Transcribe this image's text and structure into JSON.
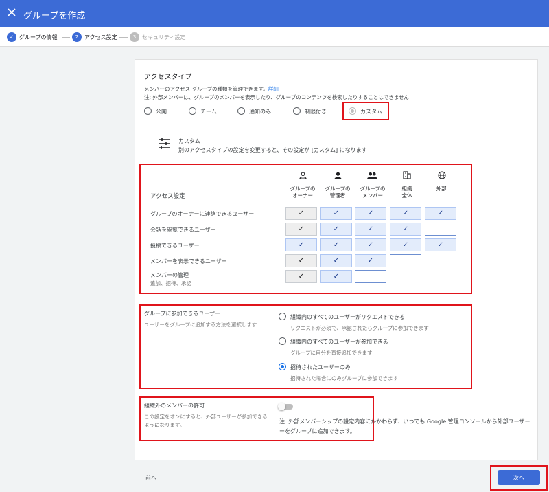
{
  "topbar": {
    "title": "グループを作成"
  },
  "stepper": [
    {
      "num": "✓",
      "label": "グループの情報"
    },
    {
      "num": "2",
      "label": "アクセス設定"
    },
    {
      "num": "3",
      "label": "セキュリティ設定"
    }
  ],
  "access_type": {
    "title": "アクセスタイプ",
    "desc": "メンバーのアクセス グループの種類を管理できます。",
    "desc_link": "詳細",
    "note": "注: 外部メンバーは、グループのメンバーを表示したり、グループのコンテンツを検索したりすることはできません",
    "options": [
      "公開",
      "チーム",
      "通知のみ",
      "制限付き",
      "カスタム"
    ],
    "selected": "カスタム"
  },
  "custom_info": {
    "title": "カスタム",
    "desc": "別のアクセスタイプの設定を変更すると、その設定が [カスタム] になります"
  },
  "access_settings": {
    "title": "アクセス設定",
    "columns": [
      {
        "l1": "グループの",
        "l2": "オーナー",
        "icon": "owner-icon"
      },
      {
        "l1": "グループの",
        "l2": "管理者",
        "icon": "manager-icon"
      },
      {
        "l1": "グループの",
        "l2": "メンバー",
        "icon": "members-icon"
      },
      {
        "l1": "組織",
        "l2": "全体",
        "icon": "organization-icon"
      },
      {
        "l1": "外部",
        "l2": "",
        "icon": "globe-icon"
      }
    ],
    "rows": [
      {
        "label": "グループのオーナーに連絡できるユーザー",
        "sub": ""
      },
      {
        "label": "会話を閲覧できるユーザー",
        "sub": ""
      },
      {
        "label": "投稿できるユーザー",
        "sub": ""
      },
      {
        "label": "メンバーを表示できるユーザー",
        "sub": ""
      },
      {
        "label": "メンバーの管理",
        "sub": "追加、招待、承認"
      }
    ]
  },
  "join": {
    "title": "グループに参加できるユーザー",
    "desc": "ユーザーをグループに追加する方法を選択します",
    "options": [
      {
        "label": "組織内のすべてのユーザーがリクエストできる",
        "sub": "リクエストが必須で、承認されたらグループに参加できます"
      },
      {
        "label": "組織内のすべてのユーザーが参加できる",
        "sub": "グループに自分を直接追加できます"
      },
      {
        "label": "招待されたユーザーのみ",
        "sub": "招待された場合にのみグループに参加できます"
      }
    ],
    "selected": "招待されたユーザーのみ"
  },
  "external": {
    "title": "組織外のメンバーの許可",
    "desc1": "この設定をオンにすると、外部ユーザーが参加できる",
    "desc2": "ようになります。",
    "note1": "注: 外部メンバーシップの設定内容にかかわらず、いつでも Google 管理コンソールから外部ユーザー",
    "note2": "ーをグループに追加できます。",
    "enabled": false
  },
  "footer": {
    "back": "前へ",
    "next": "次へ"
  }
}
